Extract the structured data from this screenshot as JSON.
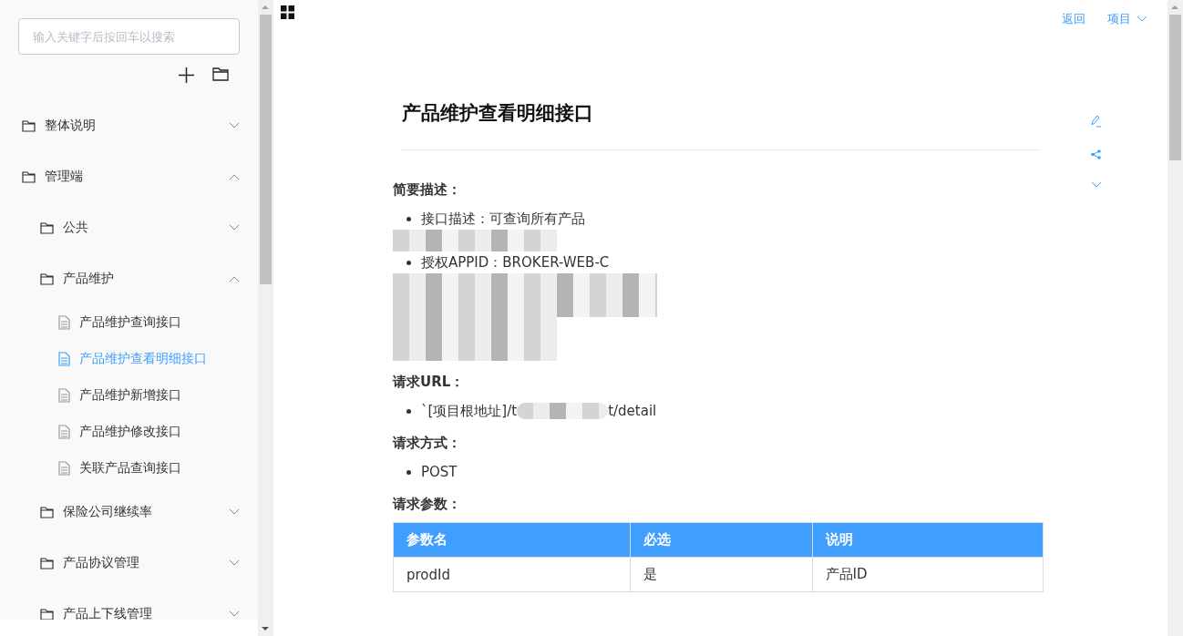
{
  "sidebar": {
    "search": {
      "placeholder": "输入关键字后按回车以搜索"
    },
    "tree": [
      {
        "label": "整体说明",
        "kind": "folder",
        "expanded": false,
        "selected": false
      },
      {
        "label": "管理端",
        "kind": "folder",
        "expanded": true,
        "selected": false,
        "children": [
          {
            "label": "公共",
            "kind": "folder",
            "expanded": false,
            "selected": false
          },
          {
            "label": "产品维护",
            "kind": "folder",
            "expanded": true,
            "selected": false,
            "children": [
              {
                "label": "产品维护查询接口",
                "kind": "doc",
                "selected": false
              },
              {
                "label": "产品维护查看明细接口",
                "kind": "doc",
                "selected": true
              },
              {
                "label": "产品维护新增接口",
                "kind": "doc",
                "selected": false
              },
              {
                "label": "产品维护修改接口",
                "kind": "doc",
                "selected": false
              },
              {
                "label": "关联产品查询接口",
                "kind": "doc",
                "selected": false
              }
            ]
          },
          {
            "label": "保险公司继续率",
            "kind": "folder",
            "expanded": false,
            "selected": false
          },
          {
            "label": "产品协议管理",
            "kind": "folder",
            "expanded": false,
            "selected": false
          },
          {
            "label": "产品上下线管理",
            "kind": "folder",
            "expanded": false,
            "selected": false
          }
        ]
      }
    ]
  },
  "header": {
    "links": [
      "返回",
      "项目"
    ]
  },
  "doc": {
    "title": "产品维护查看明细接口",
    "sections": [
      {
        "heading": "简要描述：",
        "items": [
          {
            "kind": "text",
            "text": "接口描述：可查询所有产品"
          },
          {
            "kind": "redacted"
          },
          {
            "kind": "text",
            "text": "授权APPID：BROKER-WEB-C"
          },
          {
            "kind": "redacted"
          },
          {
            "kind": "redacted"
          },
          {
            "kind": "redacted"
          },
          {
            "kind": "redacted"
          }
        ]
      },
      {
        "heading": "请求URL：",
        "items": [
          {
            "kind": "url",
            "prefix": "`[项目根地址]/t",
            "suffix": "t/detail"
          }
        ]
      },
      {
        "heading": "请求方式：",
        "items": [
          {
            "kind": "text",
            "text": "POST"
          }
        ]
      },
      {
        "heading": "请求参数：",
        "table": {
          "columns": [
            "参数名",
            "必选",
            "说明"
          ],
          "rows": [
            [
              "prodId",
              "是",
              "产品ID"
            ]
          ]
        }
      }
    ]
  }
}
